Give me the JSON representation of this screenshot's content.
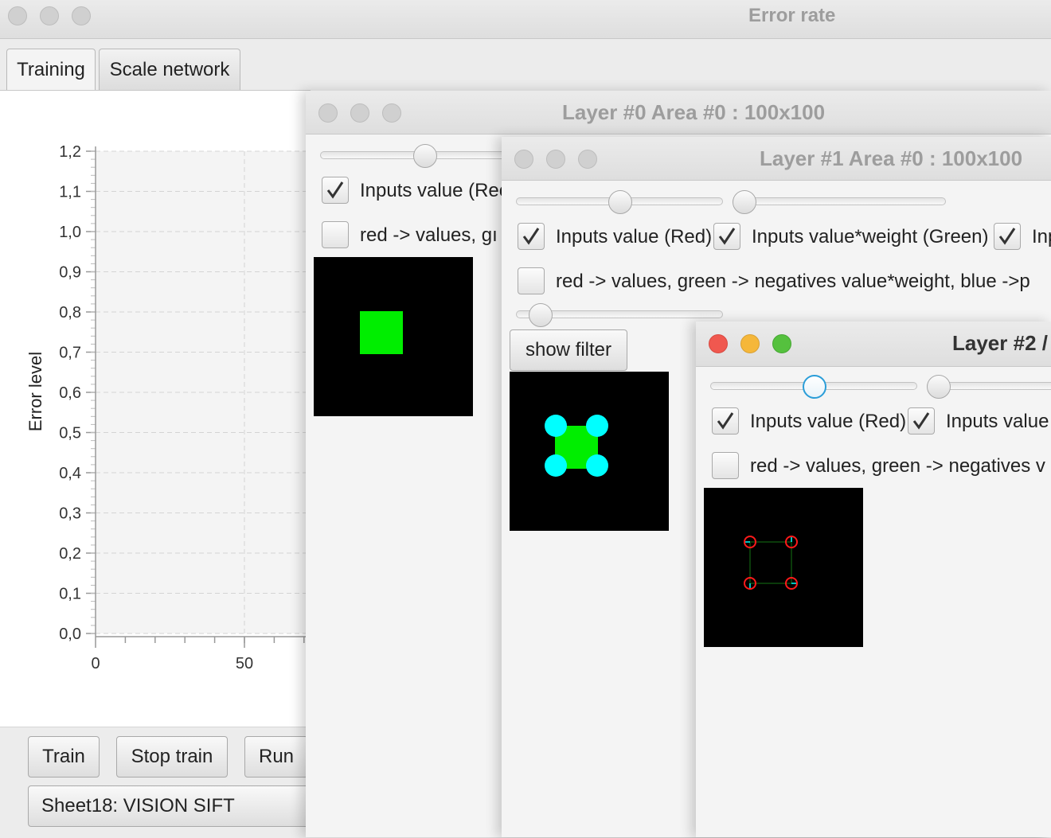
{
  "main_window": {
    "title": "Error rate",
    "tabs": [
      {
        "label": "Training",
        "active": true
      },
      {
        "label": "Scale network",
        "active": false
      }
    ],
    "buttons": {
      "train": "Train",
      "stop_train": "Stop train",
      "run": "Run"
    },
    "sheet_select": "Sheet18: VISION SIFT"
  },
  "chart_data": {
    "type": "line",
    "ylabel": "Error level",
    "xlabel": "",
    "yticks": [
      "0,0",
      "0,1",
      "0,2",
      "0,3",
      "0,4",
      "0,5",
      "0,6",
      "0,7",
      "0,8",
      "0,9",
      "1,0",
      "1,1",
      "1,2"
    ],
    "xticks": [
      "0",
      "50"
    ],
    "ylim": [
      0,
      1.2
    ],
    "xlim": [
      0,
      50
    ],
    "grid": true,
    "series": []
  },
  "layer0_window": {
    "title": "Layer #0 Area #0 : 100x100",
    "checkbox1": {
      "label": "Inputs value (Rec",
      "checked": true
    },
    "checkbox2": {
      "label": "red -> values,  gı",
      "checked": false
    },
    "slider_value": 0.5
  },
  "layer1_window": {
    "title": "Layer #1 Area #0 : 100x100",
    "checkbox_inputs_red": {
      "label": "Inputs value (Red)",
      "checked": true
    },
    "checkbox_inputs_weight_green": {
      "label": "Inputs value*weight (Green)",
      "checked": true
    },
    "checkbox_third": {
      "label": "Inp",
      "checked": true
    },
    "checkbox_legend": {
      "label": "red -> values,  green -> negatives value*weight,  blue ->p",
      "checked": false
    },
    "show_filter_button": "show filter"
  },
  "layer2_window": {
    "title": "Layer #2 /",
    "checkbox_inputs_red": {
      "label": "Inputs value (Red)",
      "checked": true
    },
    "checkbox_inputs_value": {
      "label": "Inputs value",
      "checked": true
    },
    "checkbox_legend": {
      "label": "red -> values,  green -> negatives v",
      "checked": false
    }
  },
  "colors": {
    "close": "#f0584f",
    "minimize": "#f5b73a",
    "zoom": "#55c13e",
    "focus": "#2a9dd8",
    "green_square": "#00ee00",
    "cyan": "#00ffff"
  }
}
